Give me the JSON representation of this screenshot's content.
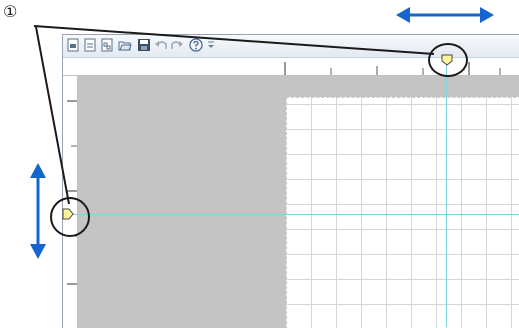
{
  "callout": {
    "number": "①"
  },
  "toolbar": {
    "buttons": [
      {
        "icon": "new-template-icon"
      },
      {
        "icon": "new-document-icon"
      },
      {
        "icon": "new-layout-icon"
      },
      {
        "icon": "open-folder-icon"
      },
      {
        "icon": "save-icon"
      },
      {
        "icon": "undo-icon"
      },
      {
        "icon": "redo-icon"
      },
      {
        "icon": "help-icon"
      },
      {
        "icon": "customize-dropdown-icon"
      }
    ]
  },
  "colors": {
    "accent_arrow": "#1466cc",
    "guide_line": "#7fd6dc",
    "marker_fill": "#fff89a",
    "canvas_gray": "#c4c4c4"
  }
}
